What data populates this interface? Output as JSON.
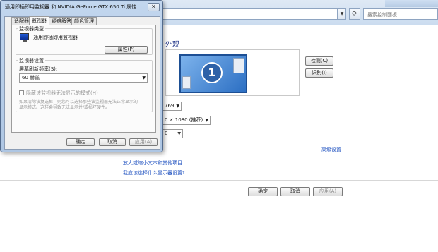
{
  "background_window": {
    "search": {
      "placeholder": "搜索控制面板"
    },
    "heading": "外观",
    "side_buttons": {
      "detect": "检测(C)",
      "identify": "识别(I)"
    },
    "monitor_number": "1",
    "combos": {
      "combo1": "769",
      "combo2": "0 × 1080 (推荐)",
      "combo3": "0"
    },
    "links": {
      "advanced": "高级设置",
      "text_size": "放大或缩小文本和其他项目",
      "help": "我应该选择什么显示器设置?"
    },
    "buttons": {
      "ok": "确定",
      "cancel": "取消",
      "apply": "应用(A)"
    }
  },
  "dialog": {
    "title": "通用即插即用监视器 和 NVIDIA GeForce GTX 650 Ti 属性",
    "tabs": [
      "适配器",
      "监视器",
      "疑难解答",
      "颜色管理"
    ],
    "monitor_type_group": "监视器类型",
    "monitor_name": "通用即插即用监视器",
    "properties_button": "属性(P)",
    "monitor_settings_group": "监视器设置",
    "refresh_label": "屏幕刷新频率(S):",
    "refresh_value": "60 赫兹",
    "hide_modes_label": "隐藏该监视器无法显示的模式(H)",
    "warning_line1": "如果清除该复选框，则您可以选择那些该监视器无法正常显示的",
    "warning_line2": "显示模式。这样会导致无法显示并/或损坏硬件。",
    "buttons": {
      "ok": "确定",
      "cancel": "取消",
      "apply": "应用(A)"
    }
  }
}
